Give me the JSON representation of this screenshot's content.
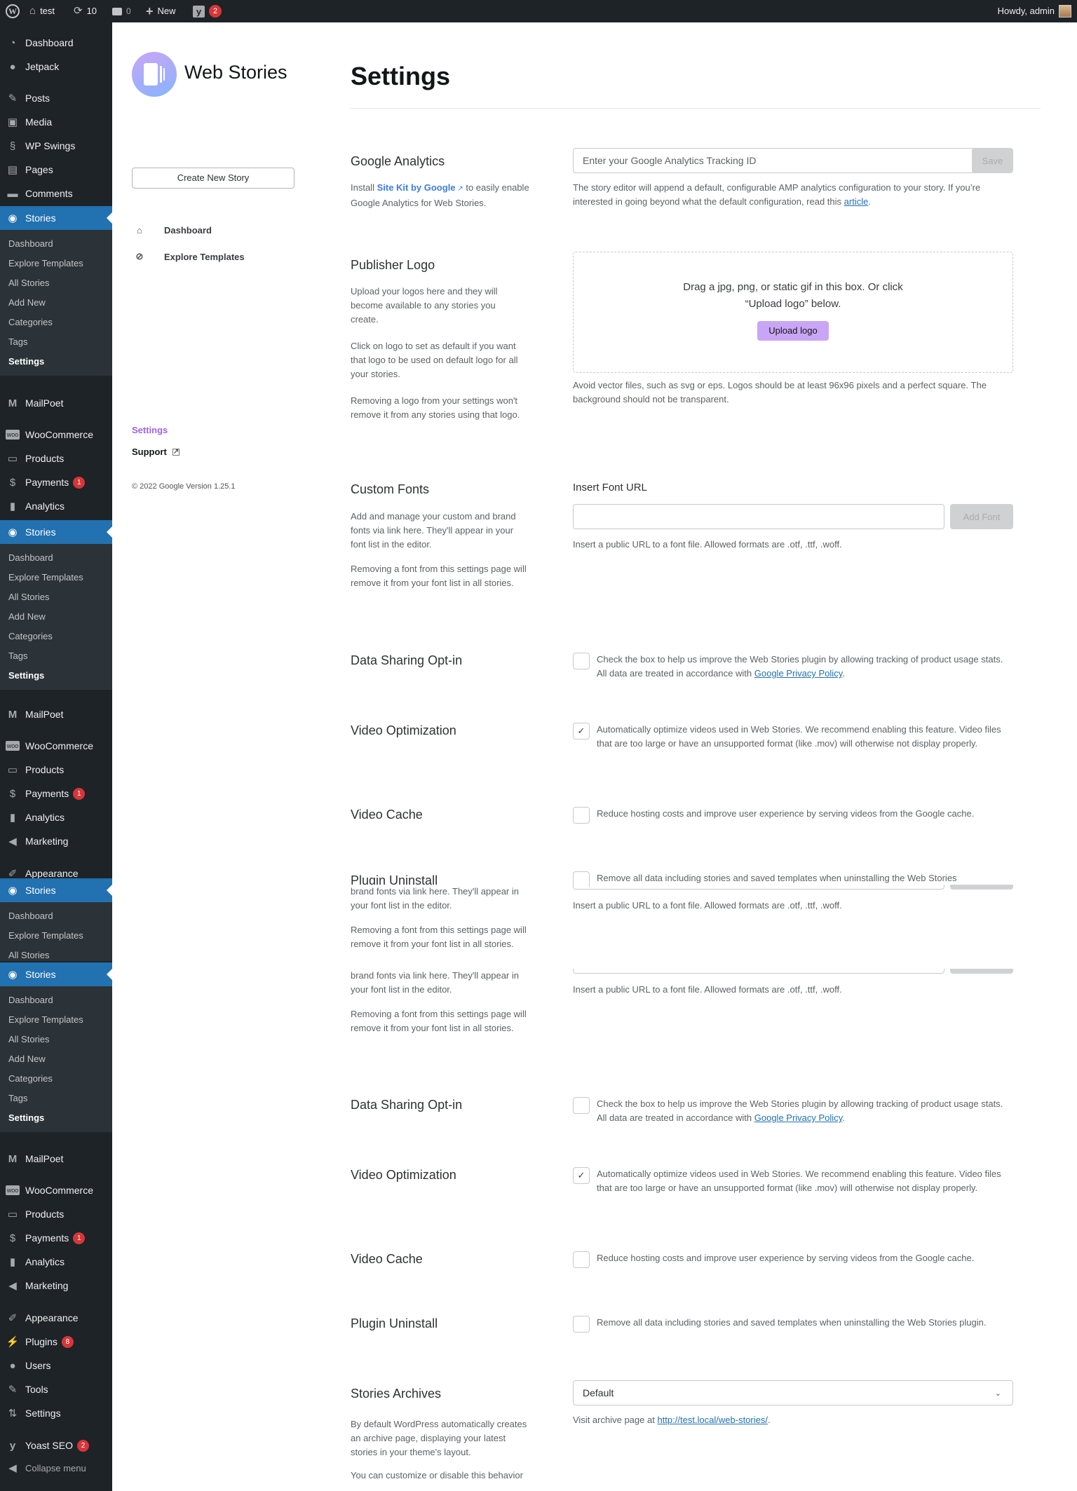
{
  "admin_bar": {
    "site_name": "test",
    "updates_count": "10",
    "comments_count": "0",
    "new_label": "New",
    "yoast_badge": "2",
    "howdy": "Howdy, admin"
  },
  "sidebar": {
    "top_items": [
      {
        "label": "Dashboard",
        "icon": "dashboard-icon"
      },
      {
        "label": "Jetpack",
        "icon": "jetpack-icon"
      },
      {
        "label": "Posts",
        "icon": "pin-icon"
      },
      {
        "label": "Media",
        "icon": "media-icon"
      },
      {
        "label": "WP Swings",
        "icon": "wpswings-icon"
      },
      {
        "label": "Pages",
        "icon": "pages-icon"
      },
      {
        "label": "Comments",
        "icon": "comment-icon"
      }
    ],
    "stories_label": "Stories",
    "stories_submenu": [
      "Dashboard",
      "Explore Templates",
      "All Stories",
      "Add New",
      "Categories",
      "Tags",
      "Settings"
    ],
    "mailpoet_label": "MailPoet",
    "woocommerce_label": "WooCommerce",
    "products_label": "Products",
    "payments_label": "Payments",
    "payments_badge": "1",
    "analytics_label": "Analytics",
    "marketing_label": "Marketing",
    "appearance_label": "Appearance",
    "plugins_label": "Plugins",
    "plugins_badge": "8",
    "users_label": "Users",
    "tools_label": "Tools",
    "settings_label": "Settings",
    "yoast_label": "Yoast SEO",
    "yoast_badge": "2",
    "collapse_label": "Collapse menu"
  },
  "left_nav": {
    "brand": "Web Stories",
    "create_button": "Create New Story",
    "items": [
      {
        "label": "Dashboard",
        "icon": "home-heart-icon"
      },
      {
        "label": "Explore Templates",
        "icon": "compass-icon"
      }
    ],
    "settings_link": "Settings",
    "support_link": "Support",
    "copyright": "© 2022 Google Version 1.25.1"
  },
  "main": {
    "title": "Settings",
    "google_analytics": {
      "label": "Google Analytics",
      "desc_prefix": "Install ",
      "desc_link": "Site Kit by Google",
      "desc_suffix": " to easily enable Google Analytics for Web Stories.",
      "input_placeholder": "Enter your Google Analytics Tracking ID",
      "input_value": "",
      "save_label": "Save",
      "help_prefix": "The story editor will append a default, configurable AMP analytics configuration to your story. If you’re interested in going beyond what the default configuration, read this ",
      "help_link": "article",
      "help_suffix": "."
    },
    "publisher_logo": {
      "label": "Publisher Logo",
      "desc": [
        "Upload your logos here and they will become available to any stories you create.",
        "Click on logo to set as default if you want that logo to be used on default logo for all your stories.",
        "Removing a logo from your settings won't remove it from any stories using that logo."
      ],
      "dropzone_text_1": "Drag a jpg, png, or static gif in this box. Or click",
      "dropzone_text_2": "“Upload logo” below.",
      "upload_label": "Upload logo",
      "help": "Avoid vector files, such as svg or eps. Logos should be at least 96x96 pixels and a perfect square. The background should not be transparent."
    },
    "custom_fonts": {
      "label": "Custom Fonts",
      "desc": [
        "Add and manage your custom and brand fonts via link here. They'll appear in your font list in the editor.",
        "Removing a font from this settings page will remove it from your font list in all stories."
      ],
      "desc_fragment_1": "brand fonts via link here. They'll appear in your font list in the editor.",
      "input_label": "Insert Font URL",
      "input_value": "",
      "add_label": "Add Font",
      "help": "Insert a public URL to a font file. Allowed formats are .otf, .ttf, .woff."
    },
    "data_sharing": {
      "label": "Data Sharing Opt-in",
      "checked": false,
      "text_prefix": "Check the box to help us improve the Web Stories plugin by allowing tracking of product usage stats. All data are treated in accordance with ",
      "link": "Google Privacy Policy",
      "text_suffix": "."
    },
    "video_optimization": {
      "label": "Video Optimization",
      "checked": true,
      "check_glyph": "✓",
      "text": "Automatically optimize videos used in Web Stories. We recommend enabling this feature. Video files that are too large or have an unsupported format (like .mov) will otherwise not display properly."
    },
    "video_cache": {
      "label": "Video Cache",
      "checked": false,
      "text": "Reduce hosting costs and improve user experience by serving videos from the Google cache."
    },
    "plugin_uninstall": {
      "label": "Plugin Uninstall",
      "checked": false,
      "text": "Remove all data including stories and saved templates when uninstalling the Web Stories plugin.",
      "text_truncated": "Remove all data including stories and saved templates when uninstalling the Web Stories"
    },
    "stories_archives": {
      "label": "Stories Archives",
      "selected": "Default",
      "desc": [
        "By default WordPress automatically creates an archive page, displaying your latest stories in your theme's layout.",
        "You can customize or disable this behavior"
      ],
      "help_prefix": "Visit archive page at ",
      "help_link": "http://test.local/web-stories/",
      "help_suffix": "."
    }
  }
}
